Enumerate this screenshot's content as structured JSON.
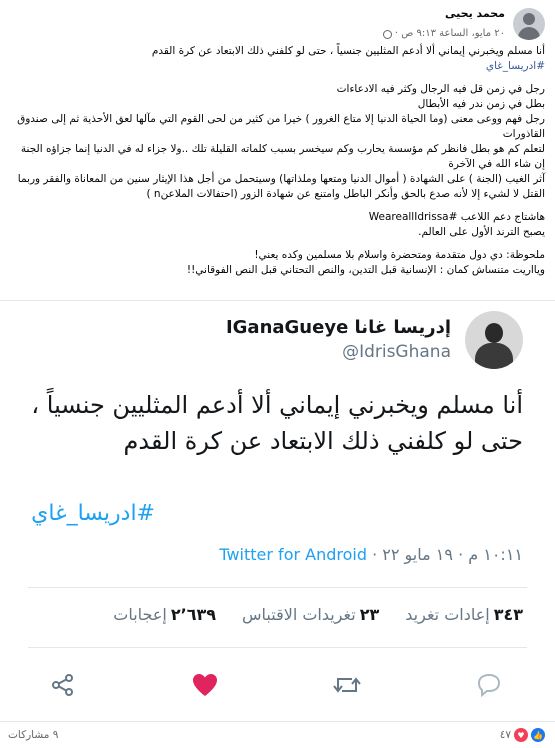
{
  "post": {
    "author_name": "محمد يحيى",
    "date": "٢٠ مايو، الساعة ٩:١٣ ص ·",
    "paragraphs": [
      [
        "أنا مسلم ويخبرني إيماني ألا أدعم المثليين جنسياً ، حتى لو كلفني ذلك الابتعاد عن كرة القدم",
        "#ادريسا_غاي"
      ],
      [
        "رجل في زمن قل فيه الرجال وكثر فيه الادعاءات",
        "بطل في زمن ندر فيه الأبطال",
        "رجل فهم ووعى معنى (وما الحياة الدنيا إلا متاع الغرور ) خيرا من كثير من لحى القوم التي مآلها لعق الأحذية ثم إلى صندوق القاذورات",
        "لتعلم كم هو بطل فانظر كم مؤسسة يحارب وكم سيخسر بسبب كلماته القليلة تلك ..ولا جزاء له في الدنيا إنما جزاؤه الجنة إن شاء الله في الآخرة",
        "آثر الغيب (الجنة ) على الشهادة ( أموال الدنيا ومتعها وملذاتها) وسيتحمل من أجل هذا الإيثار سنين من المعاناة والفقر وربما القتل لا لشيء إلا لأنه صدع بالحق وأنكر الباطل وامتنع عن شهادة الزور (احتفالات الملاعنn )"
      ],
      [
        "هاشتاج دعم اللاعب #WeareallIdrissa",
        "يصبح الترند الأول على العالم."
      ],
      [
        "ملحوظة: دي دول متقدمة ومتحضرة واسلام بلا مسلمين وكده يعني!",
        "ويااريت متنساش كمان : الإنسانية قبل التدين، والنص التحتاني قبل النص الفوقاني!!"
      ]
    ]
  },
  "tweet": {
    "display_name": "إدريسا غانا IGanaGueye",
    "handle": "@IdrisGhana",
    "body": "أنا مسلم ويخبرني إيماني ألا أدعم المثليين جنسياً ، حتى لو كلفني ذلك الابتعاد عن كرة القدم",
    "hashtag": "#ادريسا_غاي",
    "timestamp": "١٠:١١ م · ١٩ مايو ٢٢ ·",
    "source": "Twitter for Android",
    "stats": {
      "retweets_count": "٣٤٣",
      "retweets_label": "إعادات تغريد",
      "quotes_count": "٢٣",
      "quotes_label": "تغريدات الاقتباس",
      "likes_count": "٢٬٦٣٩",
      "likes_label": "إعجابات"
    }
  },
  "footer": {
    "reactions_count": "٤٧",
    "shares": "٩ مشاركات"
  },
  "colors": {
    "twitter_blue": "#1da1f2",
    "heart_pink": "#e0245e",
    "fb_blue": "#1877f2",
    "link": "#385898"
  }
}
